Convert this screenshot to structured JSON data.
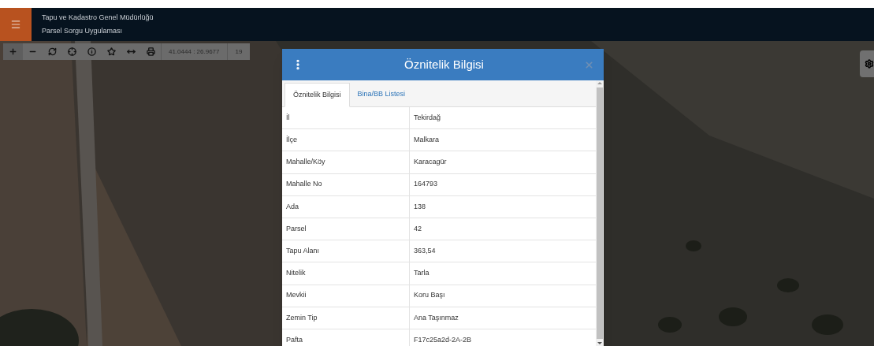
{
  "header": {
    "title": "Tapu ve Kadastro Genel Müdürlüğü",
    "subtitle": "Parsel Sorgu Uygulaması"
  },
  "toolbar": {
    "coordinates": "41.0444 : 26.9677",
    "zoom": "19"
  },
  "dialog": {
    "title": "Öznitelik Bilgisi",
    "tabs": [
      {
        "label": "Öznitelik Bilgisi",
        "selected": true
      },
      {
        "label": "Bina/BB Listesi",
        "selected": false
      }
    ],
    "rows": [
      {
        "field": "İl",
        "value": "Tekirdağ"
      },
      {
        "field": "İlçe",
        "value": "Malkara"
      },
      {
        "field": "Mahalle/Köy",
        "value": "Karacagür"
      },
      {
        "field": "Mahalle No",
        "value": "164793"
      },
      {
        "field": "Ada",
        "value": "138"
      },
      {
        "field": "Parsel",
        "value": "42"
      },
      {
        "field": "Tapu Alanı",
        "value": "363,54"
      },
      {
        "field": "Nitelik",
        "value": "Tarla"
      },
      {
        "field": "Mevkii",
        "value": "Koru Başı"
      },
      {
        "field": "Zemin Tip",
        "value": "Ana Taşınmaz"
      },
      {
        "field": "Pafta",
        "value": "F17c25a2d-2A-2B"
      }
    ]
  }
}
